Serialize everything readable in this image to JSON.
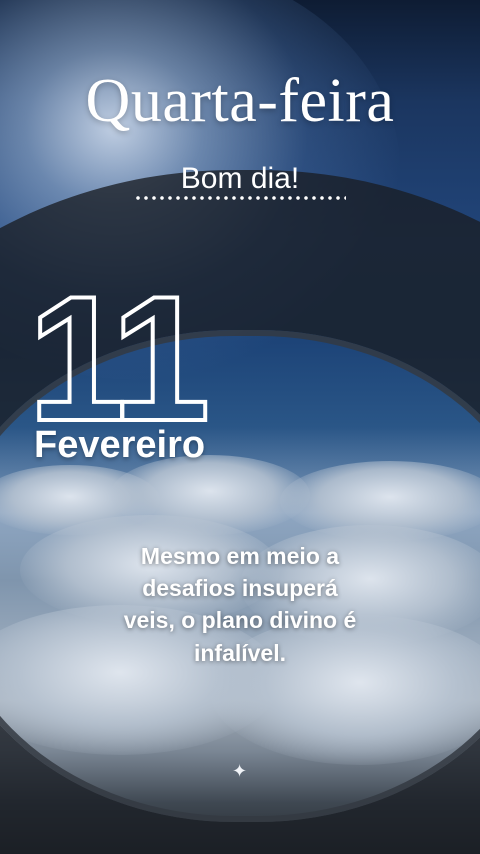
{
  "weekday": "Quarta-feira",
  "greeting": "Bom dia!",
  "date": {
    "day": "11",
    "month": "Fevereiro"
  },
  "message": {
    "line1": "Mesmo em meio a",
    "line2": "desafios insuperá",
    "line3": "veis, o plano divino é",
    "line4": "infalível."
  },
  "decorations": {
    "sparkle_icon": "sparkle-icon",
    "text_color": "#ffffff",
    "sky_color": "#21457a"
  }
}
